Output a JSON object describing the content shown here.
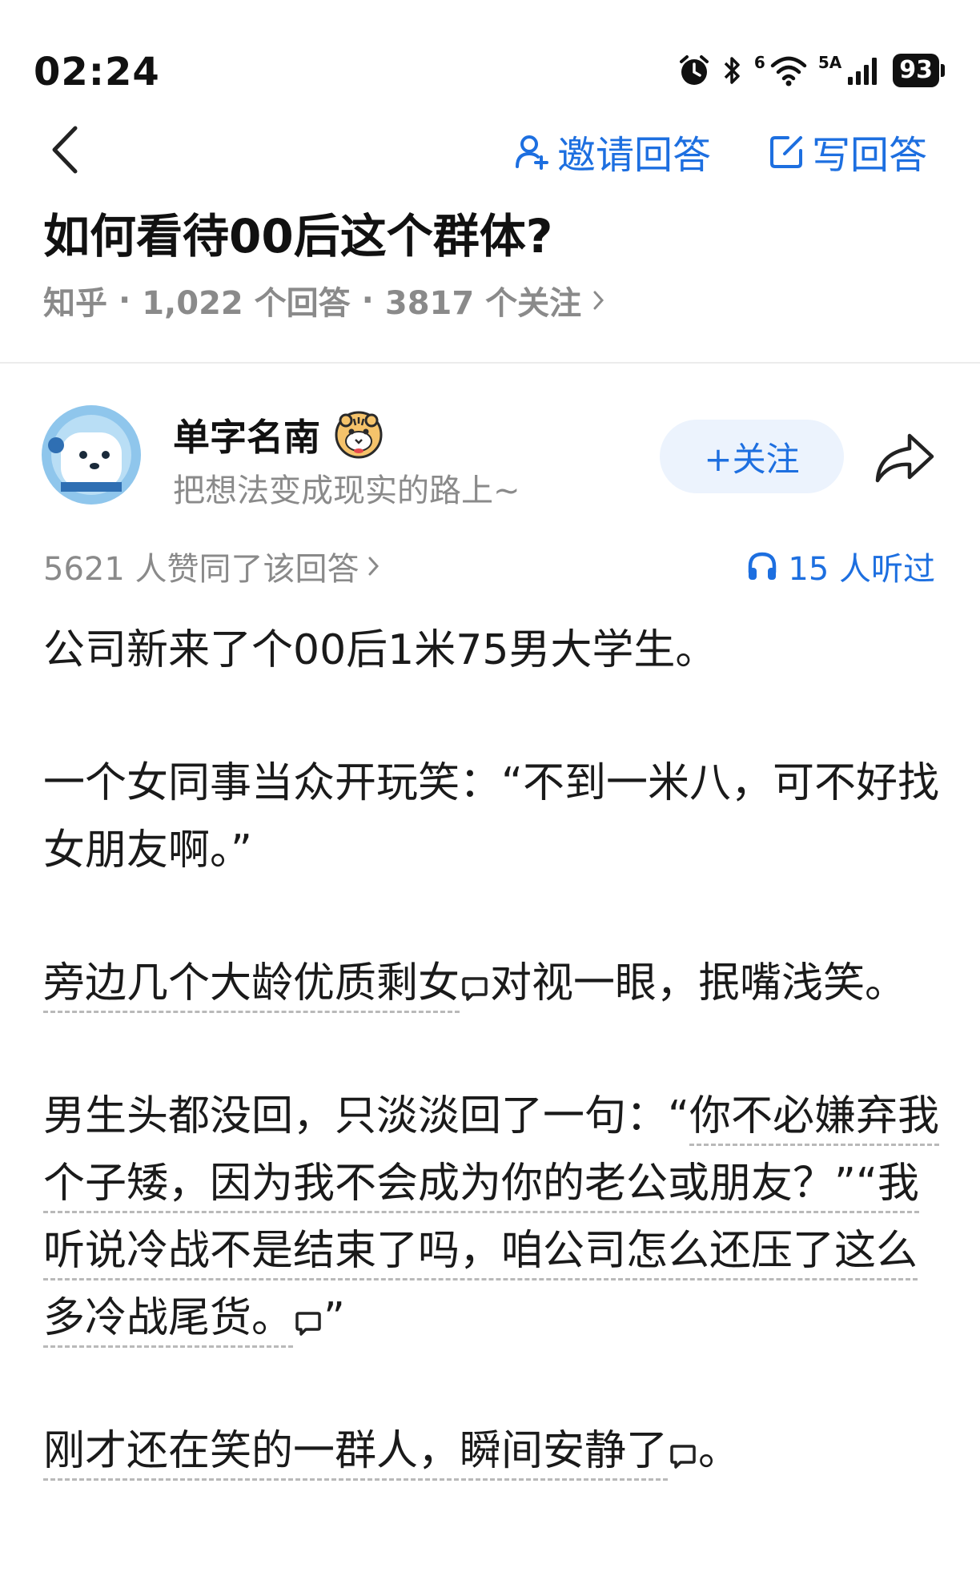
{
  "status": {
    "time": "02:24",
    "battery": "93",
    "wifi_label": "6",
    "signal_label": "5A"
  },
  "nav": {
    "invite_label": "邀请回答",
    "write_label": "写回答"
  },
  "question": {
    "title": "如何看待00后这个群体?",
    "source": "知乎",
    "answer_count": "1,022 个回答",
    "follow_count": "3817 个关注"
  },
  "author": {
    "name": "单字名南",
    "bio": "把想法变成现实的路上~",
    "follow_label": "+关注"
  },
  "answer": {
    "votes": "5621 人赞同了该回答",
    "listens": "15 人听过",
    "p1": "公司新来了个00后1米75男大学生。",
    "p2": " 一个女同事当众开玩笑：“不到一米八，可不好找女朋友啊。”",
    "p3_hl": "旁边几个大龄优质剩女",
    "p3_rest": "对视一眼，抿嘴浅笑。",
    "p4_a": "男生头都没回，只淡淡回了一句：“",
    "p4_hl": "你不必嫌弃我个子矮，因为我不会成为你的老公或朋友？”“我听说冷战不是结束了吗，咱公司怎么还压了这么多冷战尾货。",
    "p4_end": "”",
    "p5_hl": " 刚才还在笑的一群人，瞬间安静了",
    "p5_end": "。"
  },
  "colors": {
    "accent": "#1d6fe0",
    "meta": "#8a8a8a",
    "follow_bg": "#ecf3fd"
  },
  "icons": [
    "back-arrow-icon",
    "invite-person-icon",
    "edit-icon",
    "share-icon",
    "headphone-icon",
    "comment-icon",
    "alarm-icon",
    "bluetooth-icon",
    "wifi-icon",
    "signal-icon"
  ]
}
